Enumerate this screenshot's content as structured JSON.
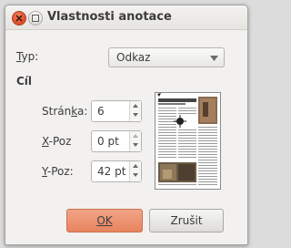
{
  "dialog": {
    "title": "Vlastnosti anotace"
  },
  "form": {
    "type_label": "Typ:",
    "type_value": "Odkaz",
    "section_target": "Cíl",
    "page_label": "Stránka:",
    "page_value": "6",
    "xpos_label": "X-Poz",
    "xpos_value": "0 pt",
    "ypos_label": "Y-Poz:",
    "ypos_value": "42 pt"
  },
  "buttons": {
    "ok_label": "OK",
    "cancel_label": "Zrušit"
  },
  "colors": {
    "ok_accent": "#e8835f",
    "close_button": "#e0532c"
  }
}
